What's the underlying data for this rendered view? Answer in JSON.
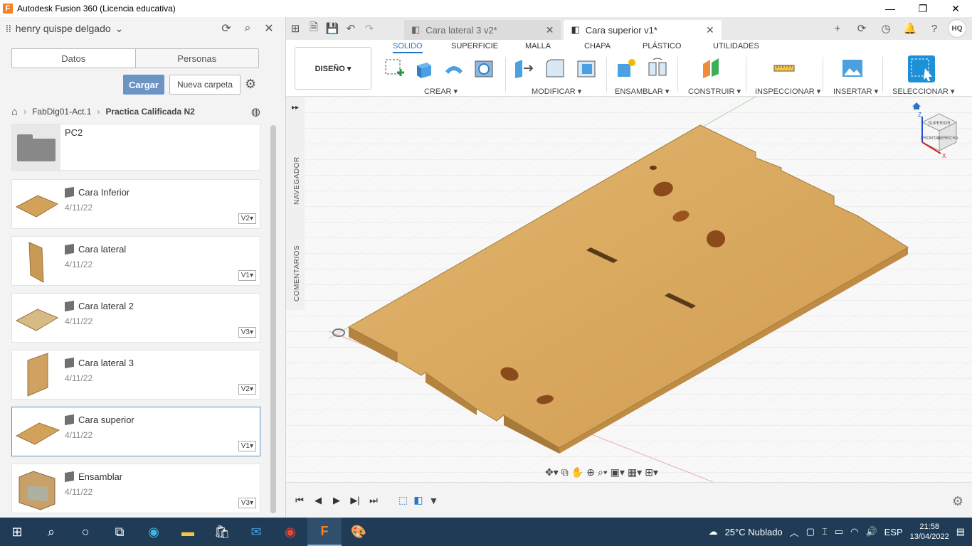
{
  "window": {
    "title": "Autodesk Fusion 360 (Licencia educativa)"
  },
  "data_panel": {
    "user": "henry quispe delgado",
    "tabs": [
      "Datos",
      "Personas"
    ],
    "upload_label": "Cargar",
    "new_folder_label": "Nueva carpeta",
    "breadcrumb": [
      "FabDig01-Act.1",
      "Practica Calificada N2"
    ],
    "folder": {
      "name": "PC2"
    },
    "files": [
      {
        "name": "Cara Inferior",
        "date": "4/11/22",
        "version": "V2▾"
      },
      {
        "name": "Cara lateral",
        "date": "4/11/22",
        "version": "V1▾"
      },
      {
        "name": "Cara lateral 2",
        "date": "4/11/22",
        "version": "V3▾"
      },
      {
        "name": "Cara lateral 3",
        "date": "4/11/22",
        "version": "V2▾"
      },
      {
        "name": "Cara superior",
        "date": "4/11/22",
        "version": "V1▾"
      },
      {
        "name": "Ensamblar",
        "date": "4/11/22",
        "version": "V3▾"
      }
    ]
  },
  "doc_tabs": [
    {
      "label": "Cara lateral 3 v2*"
    },
    {
      "label": "Cara superior v1*"
    }
  ],
  "avatar_initials": "HQ",
  "toolbar": {
    "workspace": "DISEÑO ▾",
    "workspace_tabs": [
      "SOLIDO",
      "SUPERFICIE",
      "MALLA",
      "CHAPA",
      "PLÁSTICO",
      "UTILIDADES"
    ],
    "groups": [
      "CREAR ▾",
      "MODIFICAR ▾",
      "ENSAMBLAR ▾",
      "CONSTRUIR ▾",
      "INSPECCIONAR ▾",
      "INSERTAR ▾",
      "SELECCIONAR ▾"
    ]
  },
  "side_labels": {
    "navigator": "NAVEGADOR",
    "comments": "COMENTARIOS"
  },
  "viewcube": {
    "top": "SUPERIOR",
    "front": "FRONTAL",
    "right": "DERECHA",
    "axis_x": "X",
    "axis_z": "Z"
  },
  "colors": {
    "accent": "#2a74c8",
    "wood": "#d9a95f",
    "wood_edge": "#b3833f",
    "taskbar": "#1f3b55"
  },
  "taskbar": {
    "weather": "25°C  Nublado",
    "language": "ESP",
    "time": "21:58",
    "date": "13/04/2022"
  }
}
